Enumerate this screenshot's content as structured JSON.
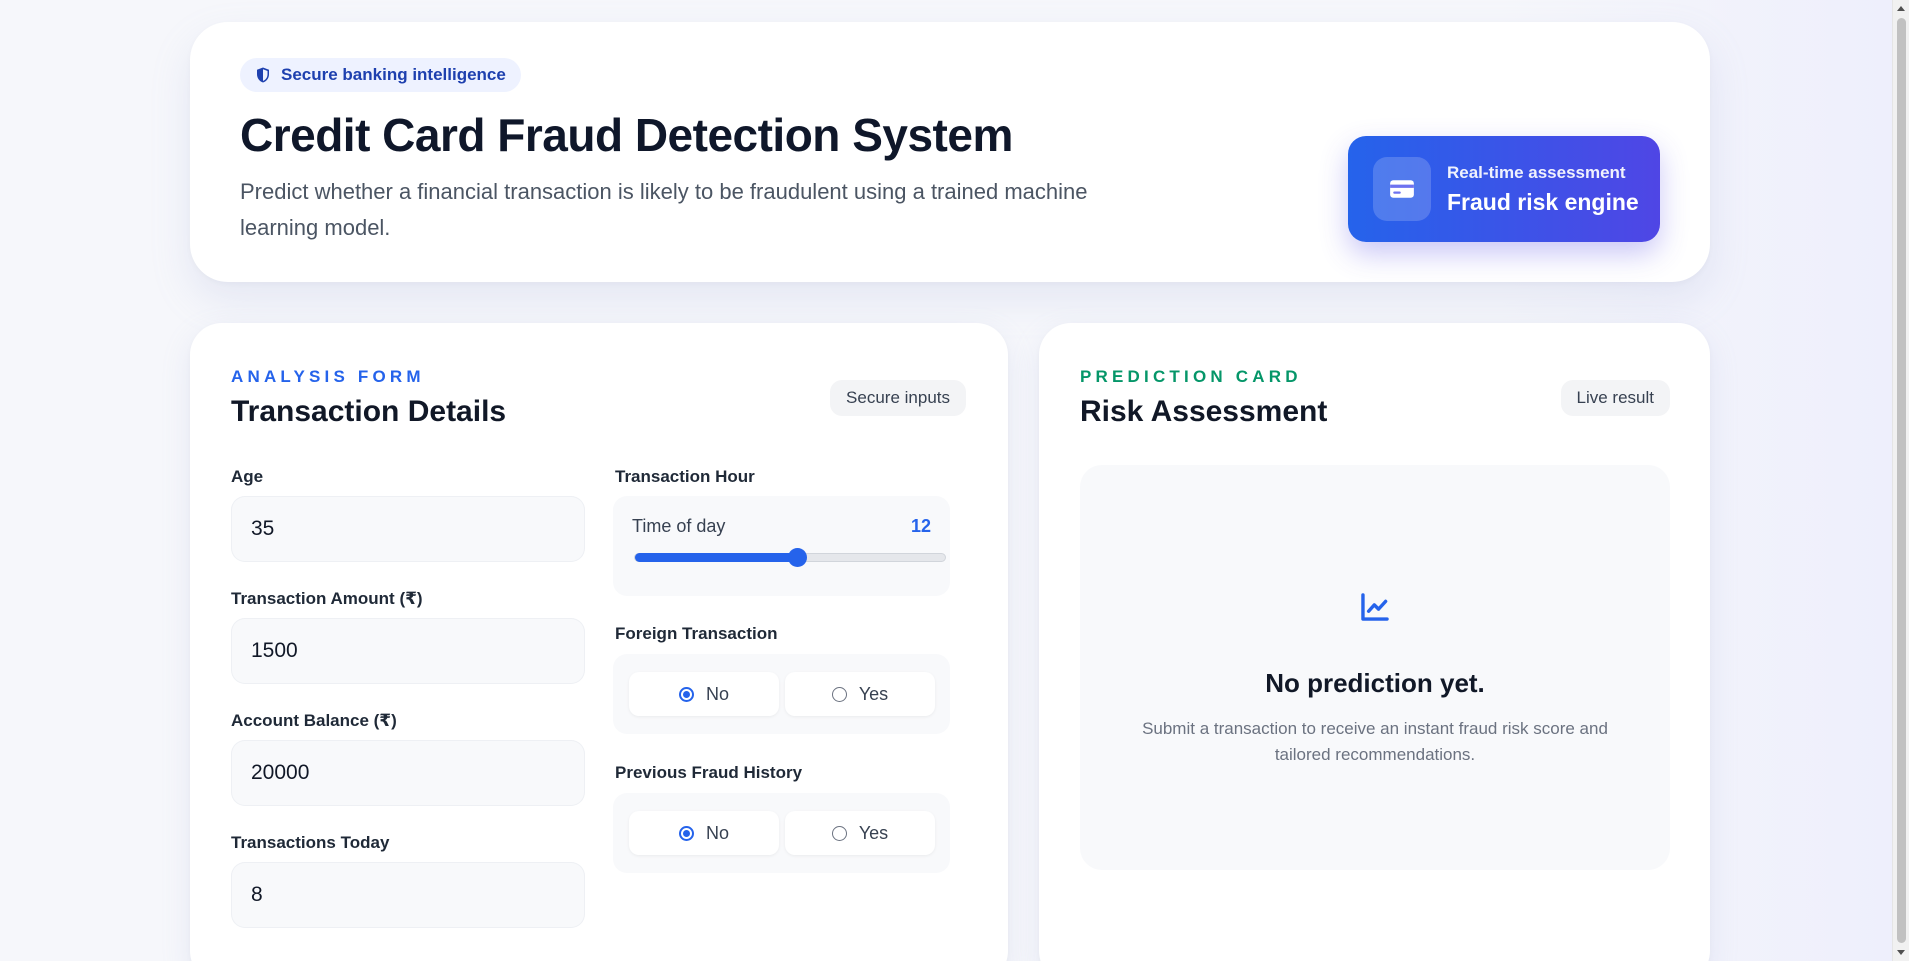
{
  "header": {
    "badge": "Secure banking intelligence",
    "title": "Credit Card Fraud Detection System",
    "subtitle": "Predict whether a financial transaction is likely to be fraudulent using a trained machine learning model.",
    "engine_small": "Real-time assessment",
    "engine_big": "Fraud risk engine"
  },
  "form": {
    "eyebrow": "ANALYSIS FORM",
    "title": "Transaction Details",
    "chip": "Secure inputs",
    "age": {
      "label": "Age",
      "value": "35"
    },
    "amount": {
      "label": "Transaction Amount (₹)",
      "value": "1500"
    },
    "balance": {
      "label": "Account Balance (₹)",
      "value": "20000"
    },
    "transactions_today": {
      "label": "Transactions Today",
      "value": "8"
    },
    "hour": {
      "label": "Transaction Hour",
      "slider_label": "Time of day",
      "value": "12",
      "min": 0,
      "max": 23
    },
    "foreign": {
      "label": "Foreign Transaction",
      "options": [
        "No",
        "Yes"
      ],
      "selected": "No"
    },
    "fraud_history": {
      "label": "Previous Fraud History",
      "options": [
        "No",
        "Yes"
      ],
      "selected": "No"
    }
  },
  "result": {
    "eyebrow": "PREDICTION CARD",
    "title": "Risk Assessment",
    "chip": "Live result",
    "empty_title": "No prediction yet.",
    "empty_desc": "Submit a transaction to receive an instant fraud risk score and tailored recommendations.",
    "icon": "chart-line-icon"
  },
  "colors": {
    "accent": "#2563eb",
    "accent_gradient_end": "#4f46e5",
    "green": "#059669"
  }
}
